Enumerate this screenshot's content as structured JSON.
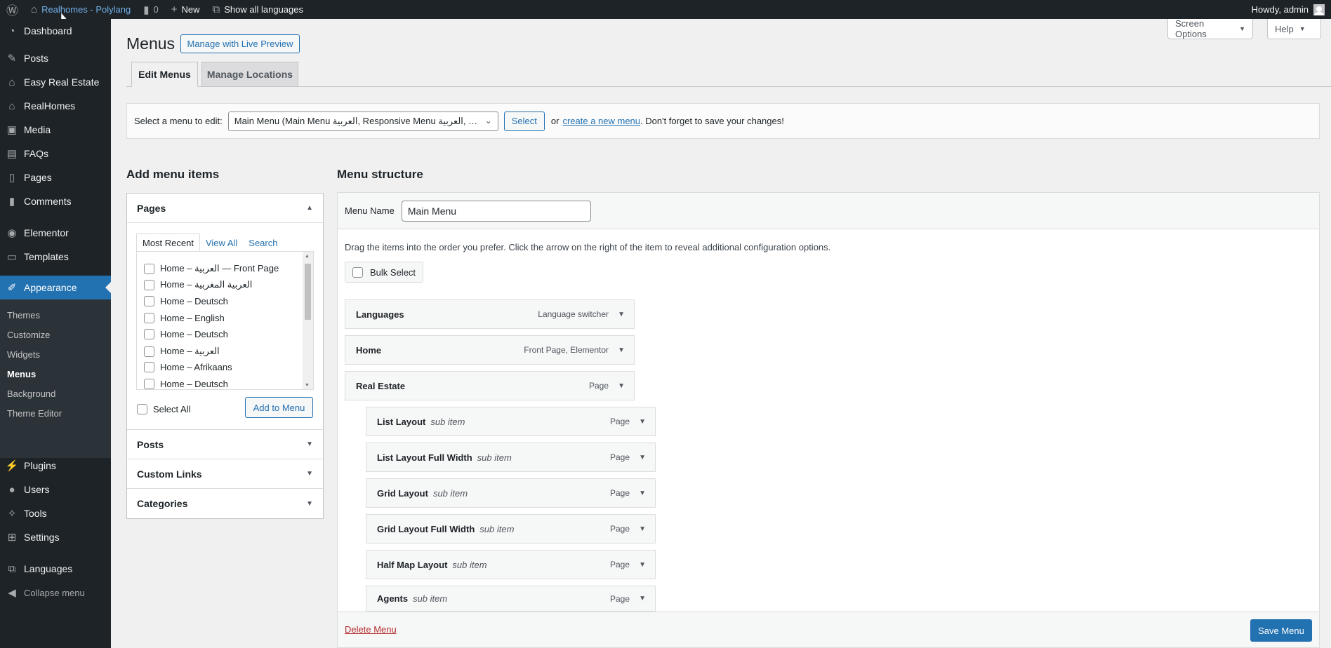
{
  "adminbar": {
    "site_name": "Realhomes - Polylang",
    "comments_count": "0",
    "new_label": "New",
    "languages_label": "Show all languages",
    "howdy": "Howdy, admin"
  },
  "sidebar": {
    "items": [
      {
        "label": "Dashboard",
        "icon": "dashboard-icon"
      },
      {
        "label": "Posts",
        "icon": "pin-icon"
      },
      {
        "label": "Easy Real Estate",
        "icon": "building-icon"
      },
      {
        "label": "RealHomes",
        "icon": "house-icon"
      },
      {
        "label": "Media",
        "icon": "media-icon"
      },
      {
        "label": "FAQs",
        "icon": "faq-icon"
      },
      {
        "label": "Pages",
        "icon": "page-icon"
      },
      {
        "label": "Comments",
        "icon": "comment-icon"
      },
      {
        "label": "Elementor",
        "icon": "elementor-icon"
      },
      {
        "label": "Templates",
        "icon": "folder-icon"
      },
      {
        "label": "Appearance",
        "icon": "brush-icon"
      },
      {
        "label": "Plugins",
        "icon": "plugin-icon"
      },
      {
        "label": "Users",
        "icon": "user-icon"
      },
      {
        "label": "Tools",
        "icon": "wrench-icon"
      },
      {
        "label": "Settings",
        "icon": "settings-icon"
      },
      {
        "label": "Languages",
        "icon": "translate-icon"
      }
    ],
    "submenu": [
      "Themes",
      "Customize",
      "Widgets",
      "Menus",
      "Background",
      "Theme Editor"
    ],
    "collapse": "Collapse menu"
  },
  "header": {
    "title": "Menus",
    "live_preview": "Manage with Live Preview",
    "screen_options": "Screen Options",
    "help": "Help",
    "tabs": [
      "Edit Menus",
      "Manage Locations"
    ]
  },
  "select_bar": {
    "label": "Select a menu to edit:",
    "selected": "Main Menu (Main Menu العربية, Responsive Menu العربية, …",
    "select_button": "Select",
    "or": "or",
    "create_link": "create a new menu",
    "suffix": ". Don't forget to save your changes!"
  },
  "add_items": {
    "title": "Add menu items",
    "pages_title": "Pages",
    "tabs": [
      "Most Recent",
      "View All",
      "Search"
    ],
    "pages": [
      "Home – العربية — Front Page",
      "Home – العربية المغربية",
      "Home – Deutsch",
      "Home – English",
      "Home – Deutsch",
      "Home – العربية",
      "Home – Afrikaans",
      "Home – Deutsch"
    ],
    "select_all": "Select All",
    "add_button": "Add to Menu",
    "sections": [
      "Posts",
      "Custom Links",
      "Categories"
    ]
  },
  "structure": {
    "title": "Menu structure",
    "name_label": "Menu Name",
    "name_value": "Main Menu",
    "instructions": "Drag the items into the order you prefer. Click the arrow on the right of the item to reveal additional configuration options.",
    "bulk_select": "Bulk Select",
    "items": [
      {
        "title": "Languages",
        "sub": "",
        "type": "Language switcher"
      },
      {
        "title": "Home",
        "sub": "",
        "type": "Front Page, Elementor"
      },
      {
        "title": "Real Estate",
        "sub": "",
        "type": "Page"
      },
      {
        "title": "List Layout",
        "sub": "sub item",
        "type": "Page"
      },
      {
        "title": "List Layout Full Width",
        "sub": "sub item",
        "type": "Page"
      },
      {
        "title": "Grid Layout",
        "sub": "sub item",
        "type": "Page"
      },
      {
        "title": "Grid Layout Full Width",
        "sub": "sub item",
        "type": "Page"
      },
      {
        "title": "Half Map Layout",
        "sub": "sub item",
        "type": "Page"
      },
      {
        "title": "Agents",
        "sub": "sub item",
        "type": "Page"
      }
    ],
    "delete_link": "Delete Menu",
    "save_button": "Save Menu"
  },
  "colors": {
    "accent": "#2271b1",
    "adminbar": "#1d2327",
    "danger": "#b32d2e"
  }
}
